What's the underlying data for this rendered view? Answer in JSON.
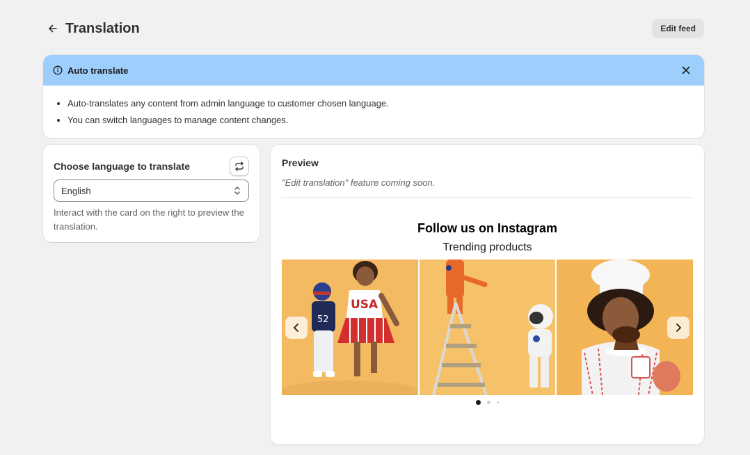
{
  "header": {
    "title": "Translation",
    "edit_feed_label": "Edit feed"
  },
  "banner": {
    "title": "Auto translate",
    "items": [
      "Auto-translates any content from admin language to customer chosen language.",
      "You can switch languages to manage content changes."
    ]
  },
  "language_card": {
    "title": "Choose language to translate",
    "selected_language": "English",
    "help_text": "Interact with the card on the right to preview the translation."
  },
  "preview": {
    "title": "Preview",
    "note": "\"Edit translation\" feature coming soon.",
    "widget_title": "Follow us on Instagram",
    "widget_subtitle": "Trending products",
    "slides": [
      "football-and-cheerleader-kids",
      "astronaut-kids-on-ladder",
      "chef-kid-with-cupcake"
    ],
    "carousel_position": 1,
    "carousel_dot_count": 3
  },
  "colors": {
    "background": "#f1f1f1",
    "banner_header": "#9ecefc",
    "slide_background": "#f2b85e",
    "text": "#303030"
  },
  "icons": [
    "arrow-left-icon",
    "info-icon",
    "close-icon",
    "refresh-icon",
    "chevron-up-down-icon",
    "chevron-left-icon",
    "chevron-right-icon"
  ]
}
